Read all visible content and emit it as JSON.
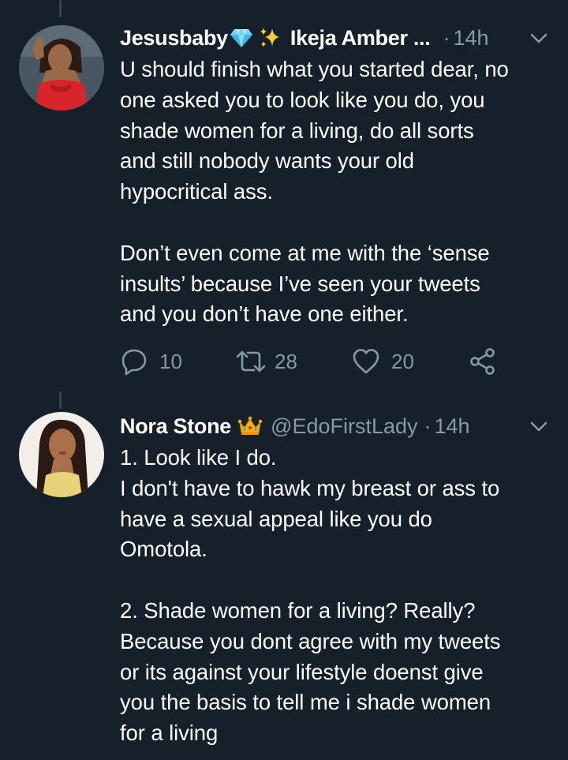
{
  "colors": {
    "background": "#15202b",
    "text_primary": "#ffffff",
    "text_secondary": "#8899a6",
    "thread_line": "#38444d"
  },
  "tweets": [
    {
      "display_name": "Jesusbaby",
      "emoji_after_name": [
        "gem-stone",
        "sparkles"
      ],
      "handle": "Ikeja Amber ...",
      "dot": "·",
      "time": "14h",
      "avatar": "woman-in-red-dress-avatar",
      "text": "U should finish what you started dear, no\none asked you to look like you do, you\nshade women for a living, do all sorts\nand still nobody wants your old\nhypocritical ass.\n\nDon’t even come at me with the ‘sense\ninsults’ because I’ve seen your tweets\nand you don’t have one either.",
      "actions": {
        "reply_count": "10",
        "retweet_count": "28",
        "like_count": "20"
      }
    },
    {
      "display_name": "Nora Stone",
      "emoji_after_name": [
        "crown"
      ],
      "handle": "@EdoFirstLady",
      "dot": "·",
      "time": "14h",
      "avatar": "woman-portrait-avatar",
      "text": "1. Look like I do.\nI don't have to hawk my breast or ass to\nhave a sexual appeal like you do\nOmotola.\n\n2. Shade women for a living? Really?\nBecause you dont agree with my tweets\nor its against your lifestyle doenst give\nyou the basis to tell me i shade women\nfor a living"
    }
  ]
}
